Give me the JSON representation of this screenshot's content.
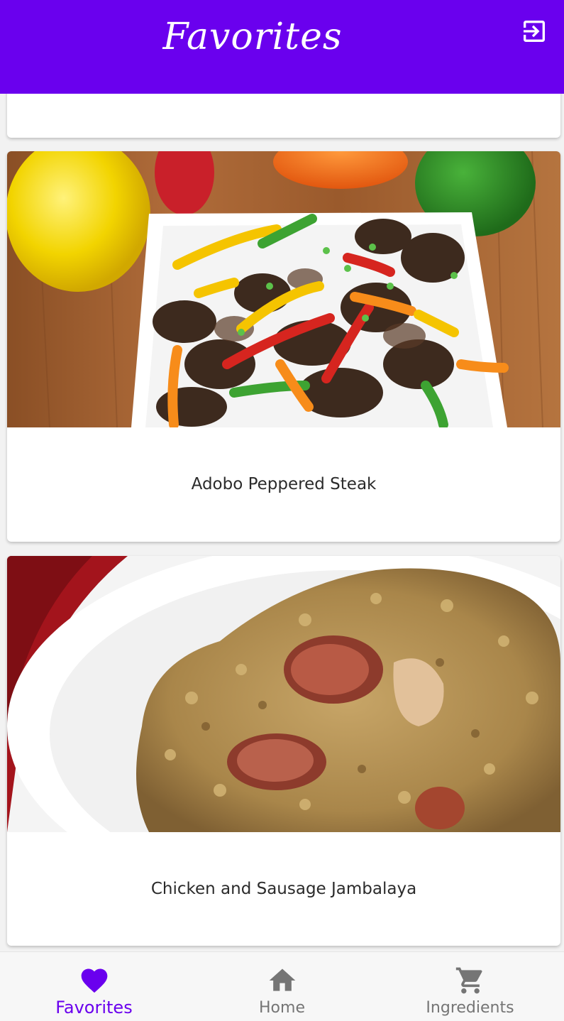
{
  "header": {
    "title": "Favorites",
    "logout_icon": "exit-to-app-icon",
    "background": "#6a00ee"
  },
  "recipes": [
    {
      "title": "Adobo Peppered Steak",
      "image": "pepper-steak-photo"
    },
    {
      "title": "Chicken and Sausage Jambalaya",
      "image": "jambalaya-photo"
    }
  ],
  "bottom_nav": {
    "items": [
      {
        "label": "Favorites",
        "icon": "heart-icon",
        "active": true
      },
      {
        "label": "Home",
        "icon": "home-icon",
        "active": false
      },
      {
        "label": "Ingredients",
        "icon": "cart-icon",
        "active": false
      }
    ],
    "active_color": "#6a00ee",
    "inactive_color": "#757575"
  }
}
